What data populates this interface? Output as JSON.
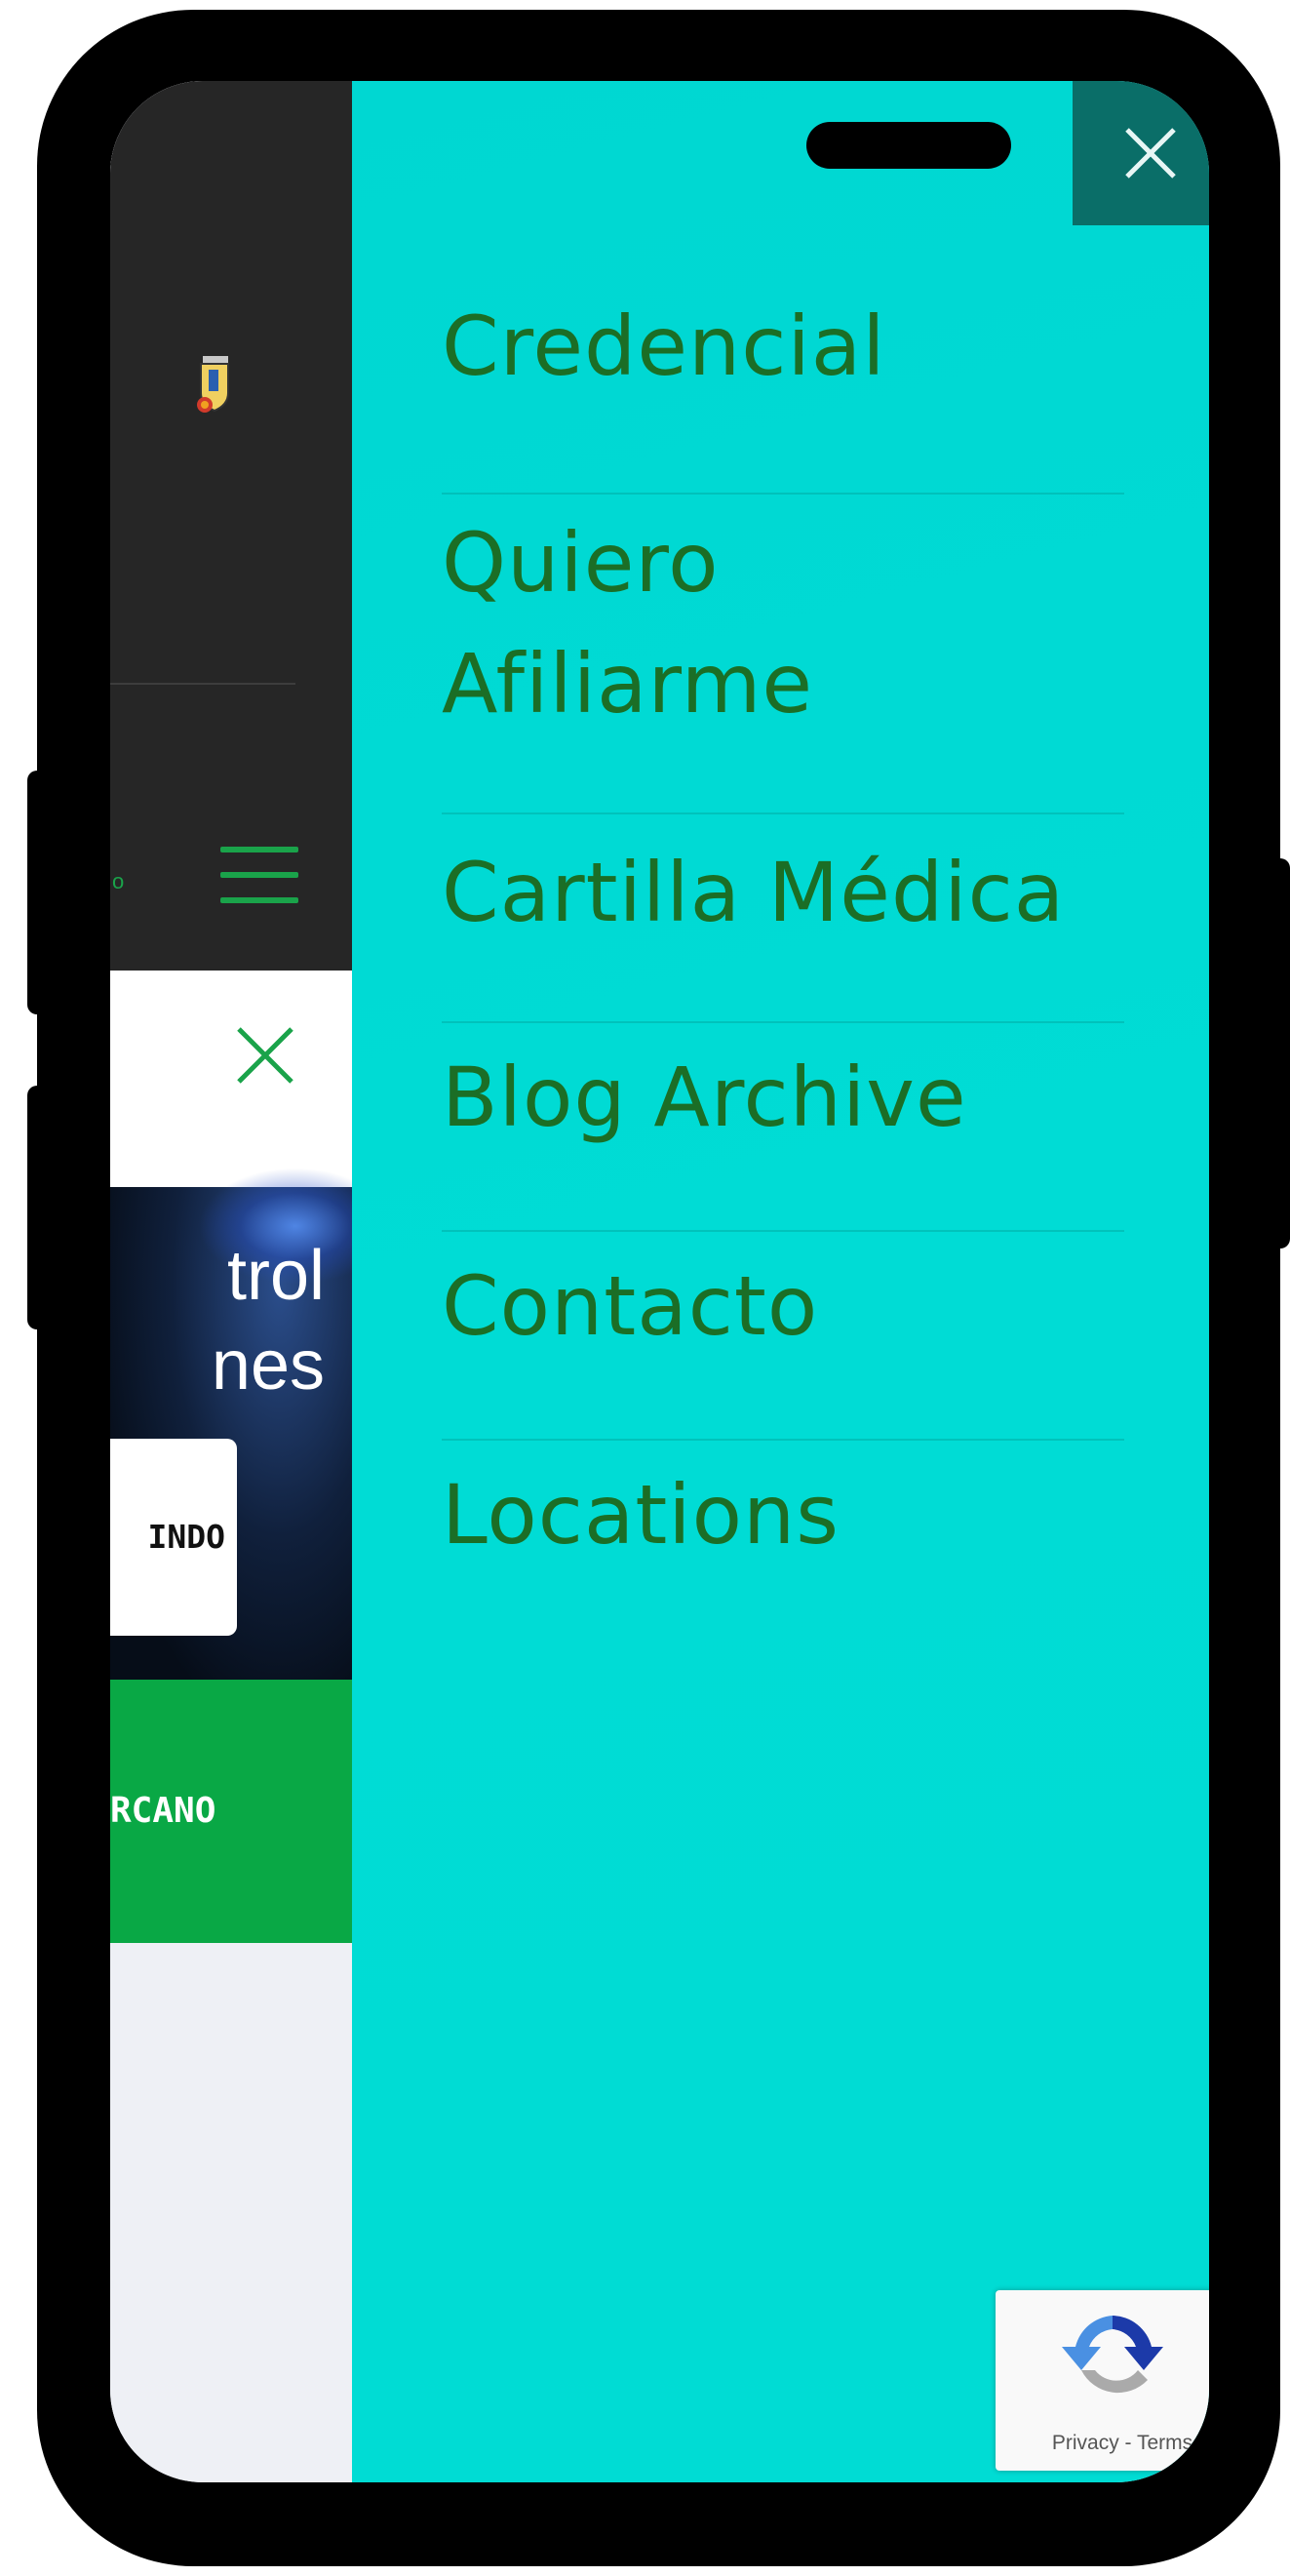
{
  "drawer": {
    "close_label": "×",
    "menu": [
      {
        "label": "Credencial"
      },
      {
        "label": "Quiero\nAfiliarme",
        "line1": "Quiero",
        "line2": "Afiliarme"
      },
      {
        "label": "Cartilla Médica"
      },
      {
        "label": "Blog Archive"
      },
      {
        "label": "Contacto"
      },
      {
        "label": "Locations"
      }
    ]
  },
  "background_site": {
    "dot": "o",
    "hero_line1": "trol",
    "hero_line2": "nes",
    "hero_button": "INDO",
    "green_band": "RCANO"
  },
  "recaptcha": {
    "links": "Privacy - Terms"
  },
  "colors": {
    "drawer_bg": "#00dcd4",
    "menu_text": "#1b6e26",
    "close_bg": "#0a6e68",
    "site_header": "#262626",
    "accent_green": "#09a845"
  }
}
